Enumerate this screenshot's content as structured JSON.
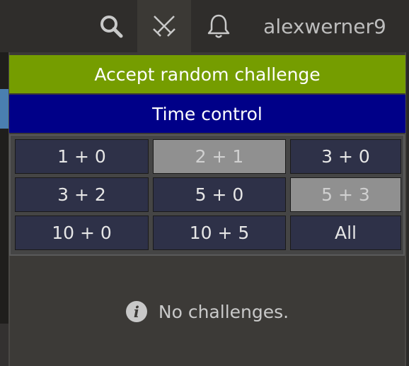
{
  "header": {
    "username": "alexwerner9",
    "icons": [
      "search-icon",
      "swords-icon",
      "bell-icon"
    ]
  },
  "challenge_panel": {
    "accept_random_label": "Accept random challenge",
    "time_control_label": "Time control",
    "time_controls": [
      {
        "label": "1 + 0",
        "enabled": true
      },
      {
        "label": "2 + 1",
        "enabled": false
      },
      {
        "label": "3 + 0",
        "enabled": true
      },
      {
        "label": "3 + 2",
        "enabled": true
      },
      {
        "label": "5 + 0",
        "enabled": true
      },
      {
        "label": "5 + 3",
        "enabled": false
      },
      {
        "label": "10 + 0",
        "enabled": true
      },
      {
        "label": "10 + 5",
        "enabled": true
      },
      {
        "label": "All",
        "enabled": true
      }
    ],
    "empty_message": "No challenges.",
    "info_glyph": "i"
  },
  "colors": {
    "accept_green": "#759d00",
    "time_control_blue": "#000088",
    "tile_dark": "#2e3148",
    "tile_disabled": "#909090"
  }
}
